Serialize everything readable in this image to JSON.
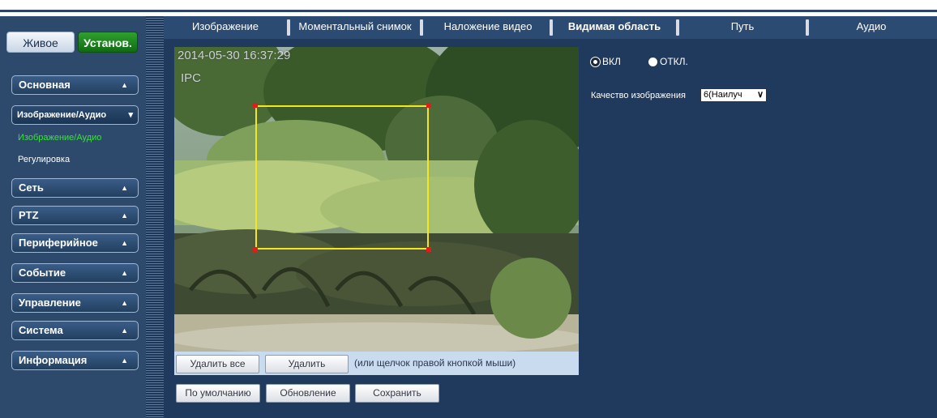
{
  "sidebar": {
    "mode_live": "Живое",
    "mode_setup": "Установ.",
    "menu": [
      {
        "label": "Основная"
      },
      {
        "label": "Изображение/Аудио"
      },
      {
        "label": "Сеть"
      },
      {
        "label": "PTZ"
      },
      {
        "label": "Периферийное"
      },
      {
        "label": "Событие"
      },
      {
        "label": "Управление"
      },
      {
        "label": "Система"
      },
      {
        "label": "Информация"
      }
    ],
    "submenu": [
      {
        "label": "Изображение/Аудио"
      },
      {
        "label": "Регулировка"
      }
    ],
    "arrow_glyph": "▲",
    "arrow_down_glyph": "▾"
  },
  "tabs": [
    {
      "label": "Изображение"
    },
    {
      "label": "Моментальный снимок"
    },
    {
      "label": "Наложение видео"
    },
    {
      "label": "Видимая область"
    },
    {
      "label": "Путь"
    },
    {
      "label": "Аудио"
    }
  ],
  "video": {
    "osd_time": "2014-05-30 16:37:29",
    "osd_name": "IPC"
  },
  "region_buttons": {
    "delete_all": "Удалить все",
    "delete": "Удалить",
    "hint": "(или щелчок правой кнопкой мыши)"
  },
  "footer_buttons": {
    "default": "По умолчанию",
    "refresh": "Обновление",
    "save": "Сохранить"
  },
  "roi": {
    "on_label": "ВКЛ",
    "off_label": "ОТКЛ.",
    "enabled": true,
    "quality_label": "Качество изображения",
    "quality_value": "6(Наилуч"
  },
  "colors": {
    "background": "#1f3a5c",
    "accent_green": "#3de03d",
    "selection_box": "#f6e622",
    "handle": "#e21b1b"
  },
  "icons": [
    "arrow-up-icon",
    "arrow-down-icon",
    "chevron-down-icon",
    "radio-icon"
  ]
}
